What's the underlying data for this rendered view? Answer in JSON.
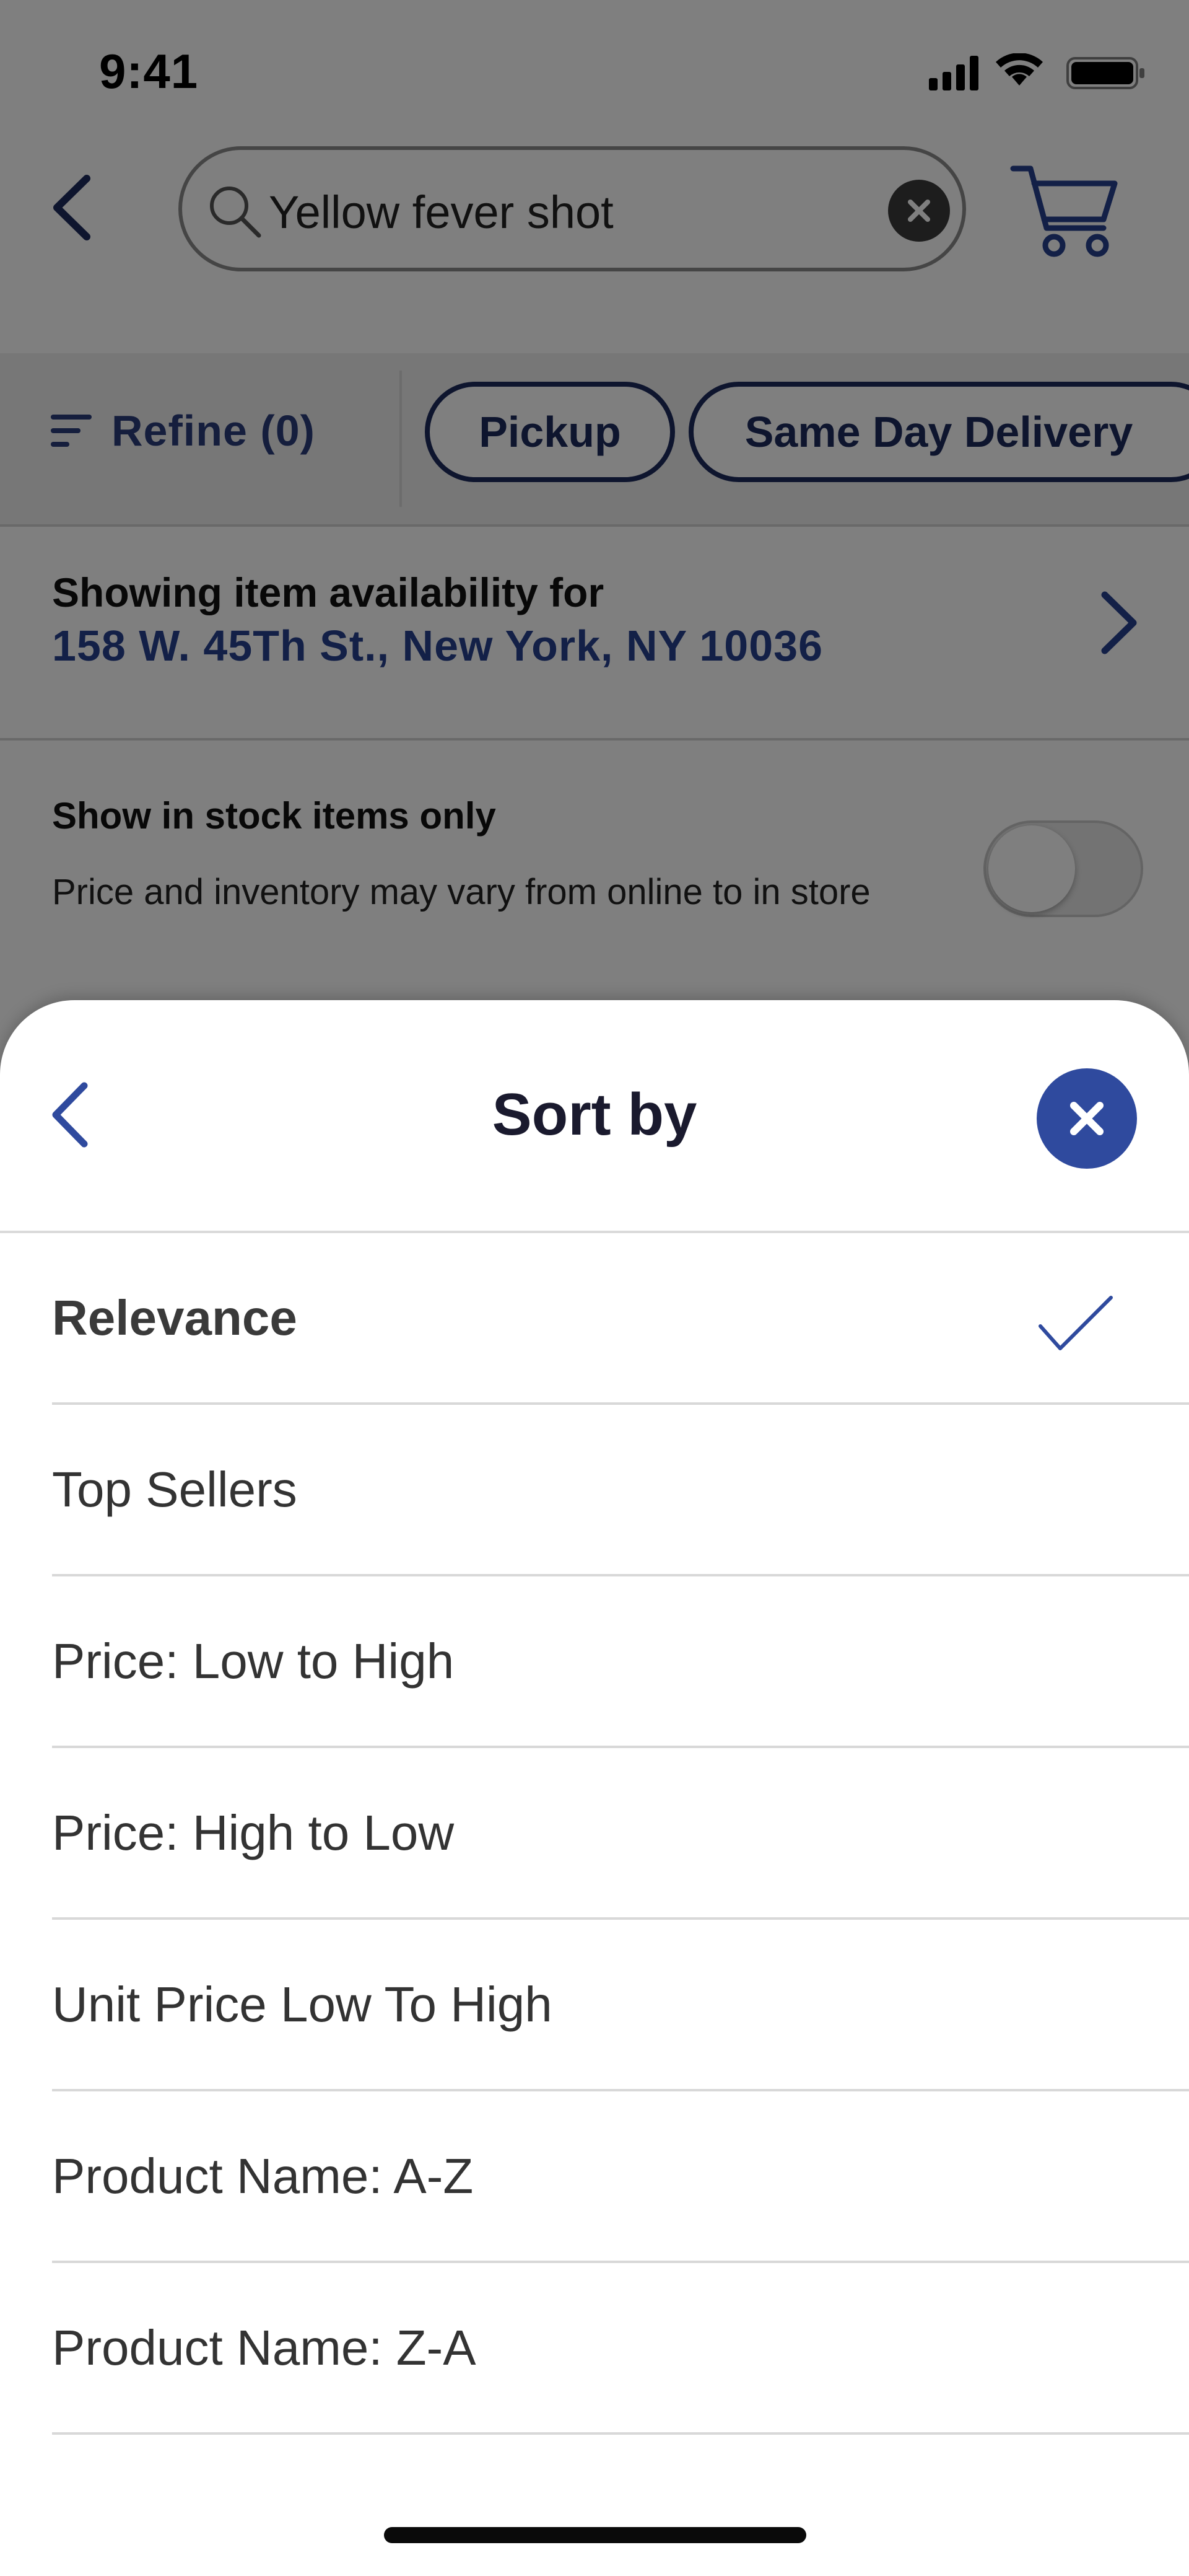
{
  "status_bar": {
    "time": "9:41",
    "icons": [
      "signal-icon",
      "wifi-icon",
      "battery-icon"
    ]
  },
  "header": {
    "back_icon": "chevron-left-icon",
    "search_value": "Yellow fever shot",
    "clear_icon": "close-icon",
    "cart_icon": "cart-icon"
  },
  "filters": {
    "refine_label": "Refine (0)",
    "chips": [
      "Pickup",
      "Same Day Delivery"
    ]
  },
  "availability": {
    "title": "Showing item availability for",
    "address": "158 W. 45Th St., New York, NY 10036"
  },
  "stock": {
    "title": "Show in stock items only",
    "subtitle": "Price and inventory may vary from online to in store",
    "toggle_on": false
  },
  "sort_sheet": {
    "title": "Sort by",
    "options": [
      {
        "label": "Relevance",
        "selected": true
      },
      {
        "label": "Top Sellers",
        "selected": false
      },
      {
        "label": "Price: Low to High",
        "selected": false
      },
      {
        "label": "Price: High to Low",
        "selected": false
      },
      {
        "label": "Unit Price Low To High",
        "selected": false
      },
      {
        "label": "Product Name: A-Z",
        "selected": false
      },
      {
        "label": "Product Name: Z-A",
        "selected": false
      }
    ]
  },
  "colors": {
    "accent_navy": "#1d2a5c",
    "link_blue": "#26408f",
    "close_button": "#2f4a9e",
    "overlay": "rgba(0,0,0,0.5)"
  }
}
